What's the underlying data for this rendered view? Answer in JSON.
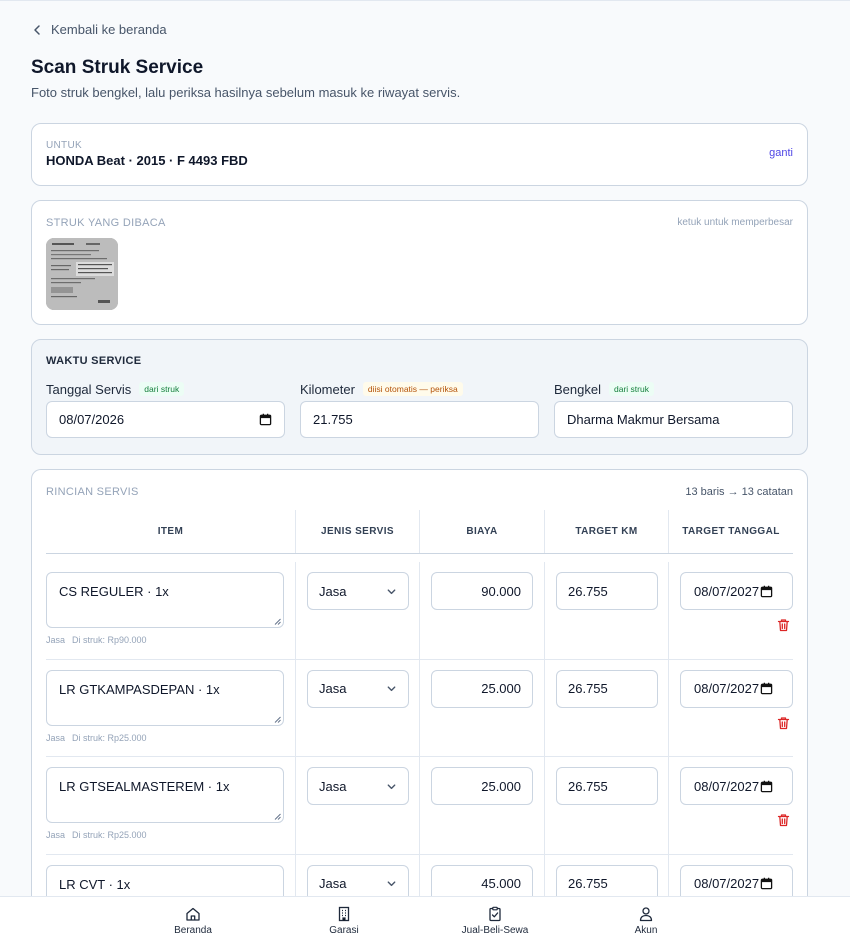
{
  "nav": {
    "back_label": "Kembali ke beranda"
  },
  "header": {
    "title": "Scan Struk Service",
    "subtitle": "Foto struk bengkel, lalu periksa hasilnya sebelum masuk ke riwayat servis."
  },
  "vehicle": {
    "label": "UNTUK",
    "value": "HONDA Beat · 2015 · F 4493 FBD",
    "change_label": "ganti"
  },
  "receipt": {
    "label": "STRUK YANG DIBACA",
    "hint": "ketuk untuk memperbesar"
  },
  "waktu": {
    "title": "WAKTU SERVICE",
    "fields": [
      {
        "label": "Tanggal Servis",
        "badge": "dari struk",
        "value": "08/07/2026"
      },
      {
        "label": "Kilometer",
        "badge": "diisi otomatis — periksa",
        "value": "21.755"
      },
      {
        "label": "Bengkel",
        "badge": "dari struk",
        "value": "Dharma Makmur Bersama"
      }
    ]
  },
  "rincian": {
    "label": "RINCIAN SERVIS",
    "count": "13 baris → 13 catatan",
    "columns": [
      "ITEM",
      "JENIS SERVIS",
      "BIAYA",
      "TARGET KM",
      "TARGET TANGGAL"
    ],
    "rows": [
      {
        "item": "CS REGULER · 1x",
        "type": "Jasa",
        "note_type": "Jasa",
        "note_receipt": "Di struk: Rp90.000",
        "cost": "90.000",
        "target_km": "26.755",
        "target_date": "08/07/2027"
      },
      {
        "item": "LR GTKAMPASDEPAN · 1x",
        "type": "Jasa",
        "note_type": "Jasa",
        "note_receipt": "Di struk: Rp25.000",
        "cost": "25.000",
        "target_km": "26.755",
        "target_date": "08/07/2027"
      },
      {
        "item": "LR GTSEALMASTEREM · 1x",
        "type": "Jasa",
        "note_type": "Jasa",
        "note_receipt": "Di struk: Rp25.000",
        "cost": "25.000",
        "target_km": "26.755",
        "target_date": "08/07/2027"
      },
      {
        "item": "LR CVT · 1x",
        "type": "Jasa",
        "note_type": "",
        "note_receipt": "",
        "cost": "45.000",
        "target_km": "26.755",
        "target_date": "08/07/2027"
      }
    ]
  },
  "bottom_nav": [
    {
      "label": "Beranda",
      "icon": "home-icon"
    },
    {
      "label": "Garasi",
      "icon": "building-icon"
    },
    {
      "label": "Jual-Beli-Sewa",
      "icon": "clipboard-check-icon"
    },
    {
      "label": "Akun",
      "icon": "user-icon"
    }
  ]
}
